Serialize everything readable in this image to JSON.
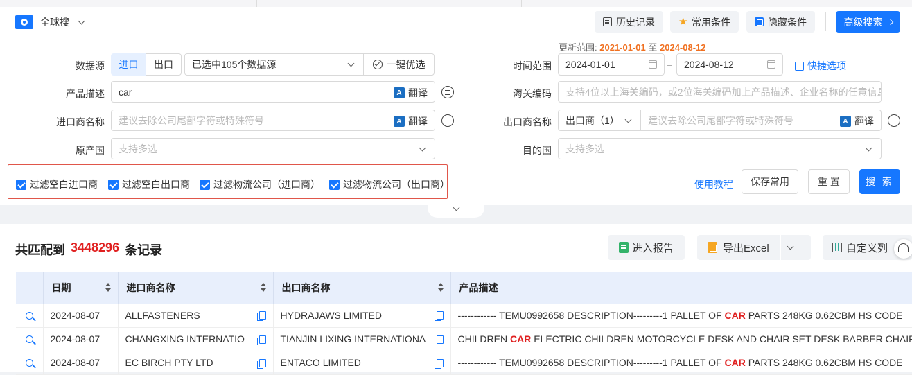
{
  "header": {
    "scope_label": "全球搜",
    "history_label": "历史记录",
    "common_label": "常用条件",
    "hide_label": "隐藏条件",
    "advanced_label": "高级搜索"
  },
  "update_range": {
    "prefix": "更新范围:",
    "start": "2021-01-01",
    "sep": "至",
    "end": "2024-08-12"
  },
  "form": {
    "datasource_label": "数据源",
    "import_label": "进口",
    "export_label": "出口",
    "datasource_value": "已选中105个数据源",
    "optimize_label": "一键优选",
    "product_label": "产品描述",
    "product_value": "car",
    "translate_label": "翻译",
    "importer_label": "进口商名称",
    "importer_placeholder": "建议去除公司尾部字符或特殊符号",
    "origin_label": "原产国",
    "origin_placeholder": "支持多选",
    "time_label": "时间范围",
    "date_start": "2024-01-01",
    "date_sep": "–",
    "date_end": "2024-08-12",
    "quick_label": "快捷选项",
    "hs_label": "海关编码",
    "hs_placeholder": "支持4位以上海关编码，或2位海关编码加上产品描述、企业名称的任意信息",
    "exporter_label": "出口商名称",
    "exporter_type": "出口商（1）",
    "exporter_placeholder": "建议去除公司尾部字符或特殊符号",
    "dest_label": "目的国",
    "dest_placeholder": "支持多选"
  },
  "filters": [
    {
      "label": "过滤空白进口商",
      "checked": true
    },
    {
      "label": "过滤空白出口商",
      "checked": true
    },
    {
      "label": "过滤物流公司（进口商）",
      "checked": true
    },
    {
      "label": "过滤物流公司（出口商）",
      "checked": true
    }
  ],
  "actions": {
    "tutorial": "使用教程",
    "save": "保存常用",
    "reset": "重 置",
    "search": "搜 索"
  },
  "results": {
    "prefix": "共匹配到",
    "count": "3448296",
    "suffix": "条记录",
    "report_label": "进入报告",
    "export_label": "导出Excel",
    "custom_label": "自定义列"
  },
  "table": {
    "headers": [
      "日期",
      "进口商名称",
      "出口商名称",
      "产品描述"
    ],
    "rows": [
      {
        "date": "2024-08-07",
        "importer": "ALLFASTENERS",
        "exporter": "HYDRAJAWS LIMITED",
        "desc_pre": "------------ TEMU0992658 DESCRIPTION---------1 PALLET OF ",
        "desc_hl": "CAR",
        "desc_post": " PARTS 248KG 0.62CBM HS CODE"
      },
      {
        "date": "2024-08-07",
        "importer": "CHANGXING INTERNATIO",
        "exporter": "TIANJIN LIXING INTERNATIONA",
        "desc_pre": "CHILDREN ",
        "desc_hl": "CAR",
        "desc_post": " ELECTRIC CHILDREN MOTORCYCLE DESK AND CHAIR SET DESK BARBER CHAIR SH"
      },
      {
        "date": "2024-08-07",
        "importer": "EC BIRCH PTY LTD",
        "exporter": "ENTACO LIMITED",
        "desc_pre": "------------ TEMU0992658 DESCRIPTION---------1 PALLET OF ",
        "desc_hl": "CAR",
        "desc_post": " PARTS 248KG 0.62CBM HS CODE"
      }
    ]
  }
}
